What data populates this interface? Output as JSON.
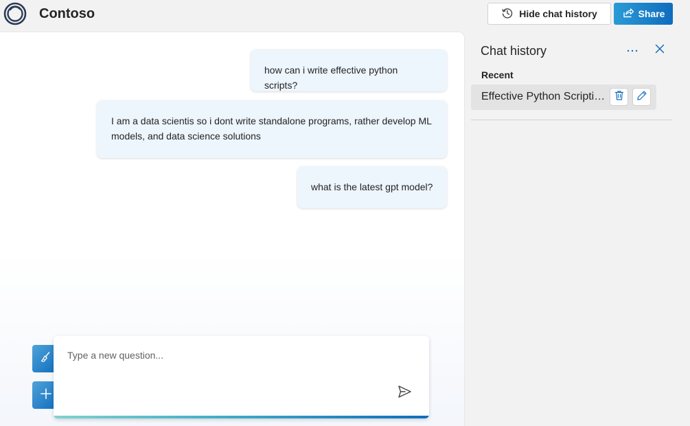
{
  "app": {
    "title": "Contoso",
    "logo_icon": "contoso-ring-logo",
    "accent_color": "#0f6cbd"
  },
  "header": {
    "hide_history_label": "Hide chat history",
    "hide_history_icon": "history-icon",
    "share_label": "Share",
    "share_icon": "share-icon"
  },
  "chat": {
    "messages": [
      {
        "role": "user",
        "text": "how can i write effective python scripts?"
      },
      {
        "role": "user",
        "text": "I am a data scientis so i dont write standalone programs, rather develop ML models, and data science solutions"
      },
      {
        "role": "user",
        "text": "what is the latest gpt model?"
      }
    ],
    "input_placeholder": "Type a new question...",
    "clear_icon": "broom-icon",
    "new_chat_icon": "plus-icon",
    "send_icon": "send-icon"
  },
  "history": {
    "title": "Chat history",
    "more_icon": "more-horizontal-icon",
    "close_icon": "close-icon",
    "section_label": "Recent",
    "items": [
      {
        "label": "Effective Python Scripting..."
      }
    ],
    "delete_icon": "trash-icon",
    "edit_icon": "pencil-icon"
  }
}
